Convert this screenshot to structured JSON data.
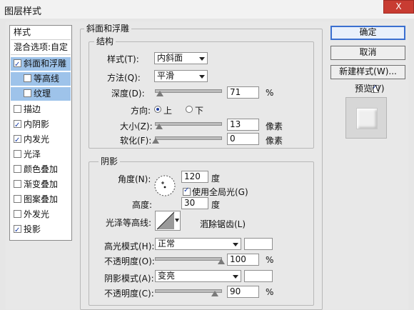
{
  "window": {
    "title": "图层样式",
    "close_label": "X"
  },
  "style_list": {
    "header": "样式",
    "blend": "混合选项:自定",
    "items": [
      {
        "label": "斜面和浮雕",
        "checked": true
      },
      {
        "label": "等高线",
        "checked": false
      },
      {
        "label": "纹理",
        "checked": false
      },
      {
        "label": "描边",
        "checked": false
      },
      {
        "label": "内阴影",
        "checked": true
      },
      {
        "label": "内发光",
        "checked": true
      },
      {
        "label": "光泽",
        "checked": false
      },
      {
        "label": "颜色叠加",
        "checked": false
      },
      {
        "label": "渐变叠加",
        "checked": false
      },
      {
        "label": "图案叠加",
        "checked": false
      },
      {
        "label": "外发光",
        "checked": false
      },
      {
        "label": "投影",
        "checked": true
      }
    ]
  },
  "bevel": {
    "group_title": "斜面和浮雕",
    "structure_title": "结构",
    "style_label": "样式(T):",
    "style_value": "内斜面",
    "method_label": "方法(Q):",
    "method_value": "平滑",
    "depth_label": "深度(D):",
    "depth_value": "71",
    "depth_unit": "%",
    "direction_label": "方向:",
    "direction_up": "上",
    "direction_down": "下",
    "size_label": "大小(Z):",
    "size_value": "13",
    "size_unit": "像素",
    "soften_label": "软化(F):",
    "soften_value": "0",
    "soften_unit": "像素"
  },
  "shading": {
    "group_title": "阴影",
    "angle_label": "角度(N):",
    "angle_value": "120",
    "angle_unit": "度",
    "global_light_label": "使用全局光(G)",
    "altitude_label": "高度:",
    "altitude_value": "30",
    "altitude_unit": "度",
    "gloss_label": "光泽等高线:",
    "antialias_label": "消除锯齿(L)",
    "highlight_mode_label": "高光模式(H):",
    "highlight_mode_value": "正常",
    "highlight_opacity_label": "不透明度(O):",
    "highlight_opacity_value": "100",
    "shadow_mode_label": "阴影模式(A):",
    "shadow_mode_value": "变亮",
    "shadow_opacity_label": "不透明度(C):",
    "shadow_opacity_value": "90",
    "percent_unit": "%"
  },
  "actions": {
    "ok_label": "确定",
    "cancel_label": "取消",
    "new_style_label": "新建样式(W)...",
    "preview_label": "预览(V)"
  },
  "sliders": {
    "depth_fraction": 0.07,
    "size_fraction": 0.05,
    "soften_fraction": 0.0,
    "highlight_opacity_fraction": 1.0,
    "shadow_opacity_fraction": 0.9
  },
  "colors": {
    "list_selection": "#9ec3ea",
    "close_button": "#c83c32",
    "primary_border": "#3a6fd0"
  },
  "icons": [
    "close-icon",
    "checkbox-icon",
    "chevron-down-icon",
    "slider-thumb-icon",
    "radio-icon",
    "angle-dial-icon",
    "gloss-contour-icon"
  ]
}
